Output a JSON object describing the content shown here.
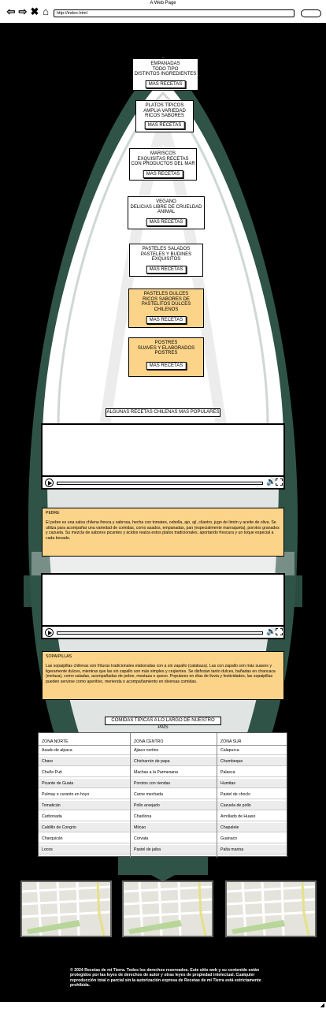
{
  "browser": {
    "window_title": "A Web Page",
    "url": "http://index.html",
    "icons": [
      "back-arrow-icon",
      "forward-arrow-icon",
      "close-x-icon",
      "home-icon"
    ]
  },
  "categories": [
    {
      "lines": "EMPANADAS\nTODO TIPO\nDISTINTOS INGREDIENTES",
      "button": "MAS RECETAS",
      "color": "#ffffff"
    },
    {
      "lines": "PLATOS TÍPICOS\nAMPLIA VARIEDAD\nRICOS SABORES",
      "button": "MAS RECETAS",
      "color": "#ffffff"
    },
    {
      "lines": "MARISCOS\nEXQUISITAS RECETAS\nCON PRODUCTOS DEL MAR",
      "button": "MAS RECETAS",
      "color": "#ffffff"
    },
    {
      "lines": "VEGANO\nDELICIAS LIBRE DE CRUELDAD\nANIMAL",
      "button": "MAS RECETAS",
      "color": "#ffffff"
    },
    {
      "lines": "PASTELES SALADOS\nPASTELES Y BUDINES\nEXQUISITOS",
      "button": "MAS RECETAS",
      "color": "#ffffff"
    },
    {
      "lines": "PASTELES DULCES\nRICOS SABORES DE\nPASTELITOS DULCES\nCHILENOS",
      "button": "MAS RECETAS",
      "color": "#fbd48a"
    },
    {
      "lines": "POSTRES\nSUAVES Y ELABORADOS\nPOSTRES",
      "button": "MAS RECETAS",
      "color": "#fbd48a"
    }
  ],
  "popular_title": "ALGUNAS RECETAS CHILENAS MAS POPULARES",
  "pebre": {
    "title": "PEBRE",
    "text": "El pebre es una salsa chilena fresca y sabrosa, hecha con tomates, cebolla, ajo, ají, cilantro, jugo de limón y aceite de oliva. Se utiliza para acompañar una variedad de comidas, como asados, empanadas, pan (especialmente marraqueta), porotos granados y cazuela. Su mezcla de sabores picantes y ácidos realza estos platos tradicionales, aportando frescura y un toque especial a cada bocado."
  },
  "sopaipillas": {
    "title": "SOPAIPILLAS",
    "text": "Las sopaipillas chilenas son frituras tradicionales elaboradas con a sin zapallo (calabaza). Las con zapallo son más suaves y ligeramente dulces, mientras que las sin zapallo son más simples y crujientes. Se disfrutan tanto dulces, bañadas en chancaca (melaza), como saladas, acompañadas de pebre, mostaza o queso. Populares en días de lluvia y festividades, las sopaipillas pueden servirse como aperitivo, merienda o acompañamiento en diversas comidas."
  },
  "table": {
    "title": "COMIDAS TÍPICAS A LO LARGO DE NUESTRO PAÍS",
    "columns": [
      {
        "header": "ZONA NORTE",
        "items": [
          "Asado de alpaca",
          "Charo",
          "Chuño Puti",
          "Picante de Guata",
          "Pulmay o curanto en hoyo",
          "Tomaticán",
          "Carbonada",
          "Caldillo de Congrio",
          "Charquicán",
          "Locos"
        ]
      },
      {
        "header": "ZONA CENTRO",
        "items": [
          "Ajiaco nortino",
          "Chicharrón de papa",
          "Machas a la Parmesana",
          "Porotos con riendas",
          "Carne mechada",
          "Pollo arvejado",
          "Charllona",
          "Milcao",
          "Corvata",
          "Pastel de jaiba"
        ]
      },
      {
        "header": "ZONA SUR",
        "items": [
          "Calapurca",
          "Chumbeque",
          "Palasca",
          "Humitas",
          "Pastel de choclo",
          "Cazuela de pollo",
          "Arrollado de Huaso",
          "Chapalele",
          "Guanaco",
          "Palta marina"
        ]
      }
    ]
  },
  "footer": {
    "text": "© 2024 Recetas de mi Tierra. Todos los derechos reservados. Este sitio web y su contenido están protegidos por las leyes de derechos de autor y otras leyes de propiedad intelectual. Cualquier reproducción total o parcial sin la autorización expresa de Recetas de mi Tierra está estrictamente prohibida."
  },
  "colors": {
    "background": "#000000",
    "leaf_green": "#2f5447",
    "accent_orange": "#fbd48a",
    "map_green": "#b9d69a",
    "map_road_yellow": "#e6e08a"
  }
}
